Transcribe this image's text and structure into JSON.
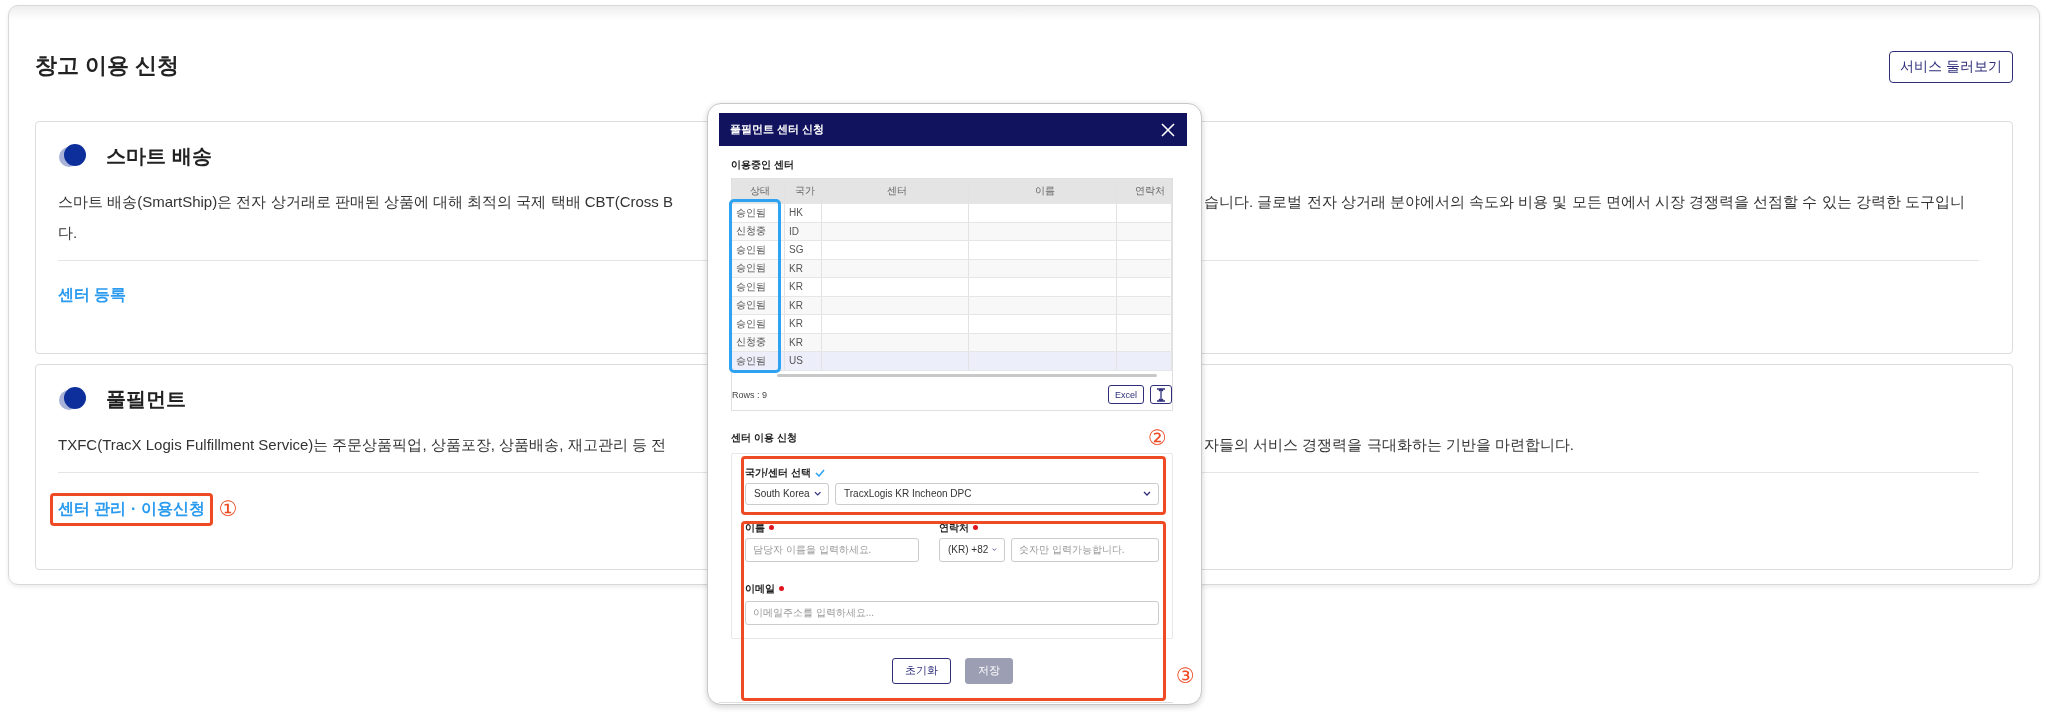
{
  "page": {
    "title": "창고 이용 신청",
    "tour_button": "서비스 둘러보기"
  },
  "services": [
    {
      "title": "스마트 배송",
      "description_lines": [
        {
          "left": "스마트 배송(SmartShip)은 전자 상거래로 판매된 상품에 대해 최적의 국제 택배 CBT(Cross B",
          "right": "습니다. 글로벌 전자 상거래 분야에서의 속도와 비용 및 모든 면에서 시장 경쟁력을 선점할 수 있는 강력한 도구입니"
        },
        {
          "left": "다."
        }
      ],
      "link": {
        "label": "센터 등록",
        "highlighted": false
      }
    },
    {
      "title": "풀필먼트",
      "description_lines": [
        {
          "left": "TXFC(TracX Logis Fulfillment Service)는 주문상품픽업, 상품포장, 상품배송, 재고관리 등 전",
          "right": "자들의 서비스 경쟁력을 극대화하는 기반을 마련합니다."
        }
      ],
      "link": {
        "label": "센터 관리 · 이용신청",
        "highlighted": true,
        "marker": "①"
      }
    }
  ],
  "dialog": {
    "title": "풀필먼트 센터 신청",
    "centers_section": "이용중인 센터",
    "table": {
      "columns": [
        "상태",
        "국가",
        "센터",
        "이름",
        "연락처"
      ],
      "status_column_highlighted": true,
      "rows": [
        {
          "status": "승인됨",
          "country": "HK",
          "selected": false
        },
        {
          "status": "신청중",
          "country": "ID",
          "selected": false
        },
        {
          "status": "승인됨",
          "country": "SG",
          "selected": false
        },
        {
          "status": "승인됨",
          "country": "KR",
          "selected": false
        },
        {
          "status": "승인됨",
          "country": "KR",
          "selected": false
        },
        {
          "status": "승인됨",
          "country": "KR",
          "selected": false
        },
        {
          "status": "승인됨",
          "country": "KR",
          "selected": false
        },
        {
          "status": "신청중",
          "country": "KR",
          "selected": false
        },
        {
          "status": "승인됨",
          "country": "US",
          "selected": true
        }
      ],
      "row_count": "Rows : 9",
      "excel_button": "Excel"
    },
    "form_section": "센터 이용 신청",
    "form": {
      "country_center_label": "국가/센터 선택",
      "country": "South Korea",
      "center": "TracxLogis KR Incheon DPC",
      "name_label": "이름",
      "name_required": true,
      "name_placeholder": "담당자 이름을 입력하세요.",
      "phone_label": "연락처",
      "phone_required": true,
      "phone_code": "(KR) +82",
      "phone_placeholder": "숫자만 입력가능합니다.",
      "email_label": "이메일",
      "email_required": true,
      "email_placeholder": "이메일주소를 입력하세요..."
    },
    "buttons": [
      {
        "label": "초기화",
        "disabled": false
      },
      {
        "label": "저장",
        "disabled": true
      }
    ],
    "callouts": [
      {
        "marker": "②"
      },
      {
        "marker": "③"
      }
    ]
  }
}
